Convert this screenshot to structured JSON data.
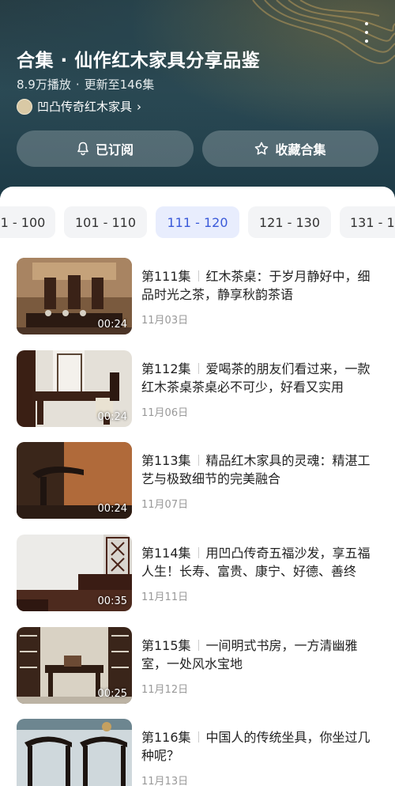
{
  "header": {
    "title": "合集 · 仙作红木家具分享品鉴",
    "plays": "8.9万播放",
    "dot": "·",
    "updated": "更新至146集",
    "author": "凹凸传奇红木家具",
    "author_chevron": "›",
    "subscribed_label": "已订阅",
    "collect_label": "收藏合集"
  },
  "tabs": [
    "1 - 100",
    "101 - 110",
    "111 - 120",
    "121 - 130",
    "131 - 1"
  ],
  "active_tab": "111 - 120",
  "episodes": [
    {
      "num": "第111集",
      "title": "红木茶桌：于岁月静好中，细品时光之茶，静享秋韵茶语",
      "date": "11月03日",
      "duration": "00:24"
    },
    {
      "num": "第112集",
      "title": "爱喝茶的朋友们看过来，一款红木茶桌茶桌必不可少，好看又实用",
      "date": "11月06日",
      "duration": "00:24"
    },
    {
      "num": "第113集",
      "title": "精品红木家具的灵魂：精湛工艺与极致细节的完美融合",
      "date": "11月07日",
      "duration": "00:24"
    },
    {
      "num": "第114集",
      "title": "用凹凸传奇五福沙发，享五福人生！长寿、富贵、康宁、好德、善终",
      "date": "11月11日",
      "duration": "00:35"
    },
    {
      "num": "第115集",
      "title": "一间明式书房，一方清幽雅室，一处风水宝地",
      "date": "11月12日",
      "duration": "00:25"
    },
    {
      "num": "第116集",
      "title": "中国人的传统坐具，你坐过几种呢？",
      "date": "11月13日",
      "duration": ""
    }
  ],
  "colors": {
    "accent": "#3a5ad9",
    "active_tab_bg": "#e8edfd",
    "header_bg": "#263b42"
  }
}
